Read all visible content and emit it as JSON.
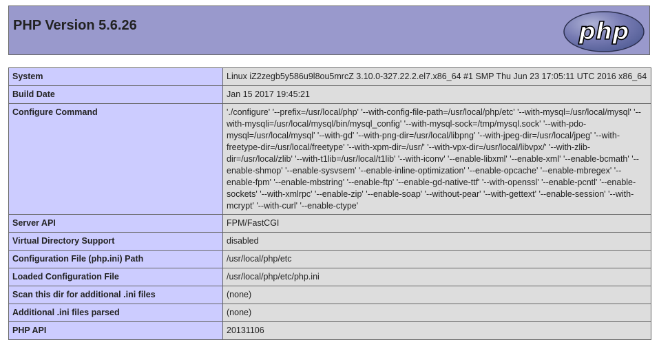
{
  "page": {
    "title": "PHP Version 5.6.26",
    "logo_text": "php"
  },
  "colors": {
    "header_bg": "#9999cc",
    "key_bg": "#ccccff",
    "value_bg": "#dddddd",
    "border": "#666666"
  },
  "rows": [
    {
      "key": "System",
      "value": "Linux iZ2zegb5y586u9l8ou5mrcZ 3.10.0-327.22.2.el7.x86_64 #1 SMP Thu Jun 23 17:05:11 UTC 2016 x86_64"
    },
    {
      "key": "Build Date",
      "value": "Jan 15 2017 19:45:21"
    },
    {
      "key": "Configure Command",
      "value": "'./configure' '--prefix=/usr/local/php' '--with-config-file-path=/usr/local/php/etc' '--with-mysql=/usr/local/mysql' '--with-mysqli=/usr/local/mysql/bin/mysql_config' '--with-mysql-sock=/tmp/mysql.sock' '--with-pdo-mysql=/usr/local/mysql' '--with-gd' '--with-png-dir=/usr/local/libpng' '--with-jpeg-dir=/usr/local/jpeg' '--with-freetype-dir=/usr/local/freetype' '--with-xpm-dir=/usr/' '--with-vpx-dir=/usr/local/libvpx/' '--with-zlib-dir=/usr/local/zlib' '--with-t1lib=/usr/local/t1lib' '--with-iconv' '--enable-libxml' '--enable-xml' '--enable-bcmath' '--enable-shmop' '--enable-sysvsem' '--enable-inline-optimization' '--enable-opcache' '--enable-mbregex' '--enable-fpm' '--enable-mbstring' '--enable-ftp' '--enable-gd-native-ttf' '--with-openssl' '--enable-pcntl' '--enable-sockets' '--with-xmlrpc' '--enable-zip' '--enable-soap' '--without-pear' '--with-gettext' '--enable-session' '--with-mcrypt' '--with-curl' '--enable-ctype'"
    },
    {
      "key": "Server API",
      "value": "FPM/FastCGI"
    },
    {
      "key": "Virtual Directory Support",
      "value": "disabled"
    },
    {
      "key": "Configuration File (php.ini) Path",
      "value": "/usr/local/php/etc"
    },
    {
      "key": "Loaded Configuration File",
      "value": "/usr/local/php/etc/php.ini"
    },
    {
      "key": "Scan this dir for additional .ini files",
      "value": "(none)"
    },
    {
      "key": "Additional .ini files parsed",
      "value": "(none)"
    },
    {
      "key": "PHP API",
      "value": "20131106"
    }
  ]
}
